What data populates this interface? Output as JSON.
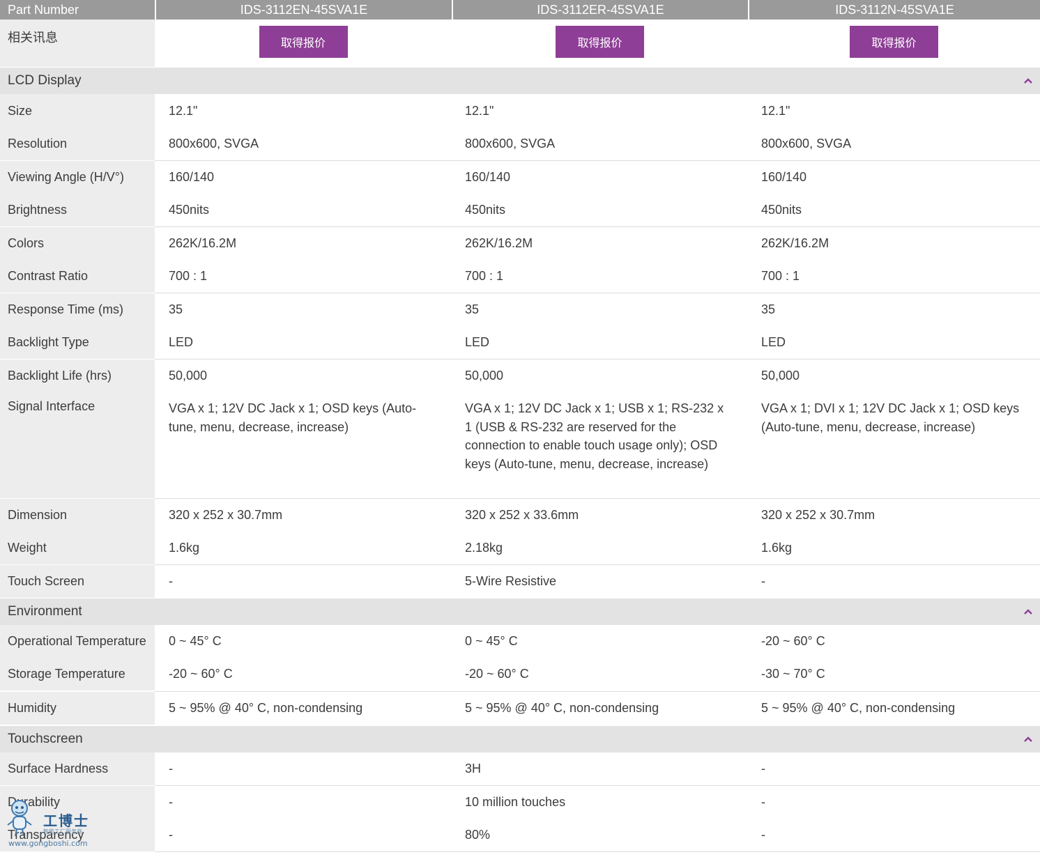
{
  "header": {
    "label": "Part Number",
    "products": [
      "IDS-3112EN-45SVA1E",
      "IDS-3112ER-45SVA1E",
      "IDS-3112N-45SVA1E"
    ]
  },
  "related": {
    "label": "相关讯息",
    "button_label": "取得报价"
  },
  "sections": {
    "lcd": {
      "title": "LCD Display"
    },
    "environment": {
      "title": "Environment"
    },
    "touchscreen": {
      "title": "Touchscreen"
    }
  },
  "rows": {
    "size": {
      "label": "Size",
      "values": [
        "12.1\"",
        "12.1\"",
        "12.1\""
      ]
    },
    "resolution": {
      "label": "Resolution",
      "values": [
        "800x600, SVGA",
        "800x600, SVGA",
        "800x600, SVGA"
      ]
    },
    "viewing_angle": {
      "label": "Viewing Angle (H/V°)",
      "values": [
        "160/140",
        "160/140",
        "160/140"
      ]
    },
    "brightness": {
      "label": "Brightness",
      "values": [
        "450nits",
        "450nits",
        "450nits"
      ]
    },
    "colors": {
      "label": "Colors",
      "values": [
        "262K/16.2M",
        "262K/16.2M",
        "262K/16.2M"
      ]
    },
    "contrast": {
      "label": "Contrast Ratio",
      "values": [
        "700 : 1",
        "700 : 1",
        "700 : 1"
      ]
    },
    "response": {
      "label": "Response Time (ms)",
      "values": [
        "35",
        "35",
        "35"
      ]
    },
    "backlight_type": {
      "label": "Backlight Type",
      "values": [
        "LED",
        "LED",
        "LED"
      ]
    },
    "backlight_life": {
      "label": "Backlight Life (hrs)",
      "values": [
        "50,000",
        "50,000",
        "50,000"
      ]
    },
    "signal": {
      "label": "Signal Interface",
      "values": [
        "VGA x 1; 12V DC Jack x 1; OSD keys (Auto-tune, menu, decrease, increase)",
        "VGA x 1; 12V DC Jack x 1; USB x 1; RS-232 x 1 (USB & RS-232 are reserved for the connection to enable touch usage only); OSD keys (Auto-tune, menu, decrease, increase)",
        "VGA x 1; DVI x 1; 12V DC Jack x 1; OSD keys (Auto-tune, menu, decrease, increase)"
      ]
    },
    "dimension": {
      "label": "Dimension",
      "values": [
        "320 x 252 x 30.7mm",
        "320 x 252 x 33.6mm",
        "320 x 252 x 30.7mm"
      ]
    },
    "weight": {
      "label": "Weight",
      "values": [
        "1.6kg",
        "2.18kg",
        "1.6kg"
      ]
    },
    "touch_screen": {
      "label": "Touch Screen",
      "values": [
        "-",
        "5-Wire Resistive",
        "-"
      ]
    },
    "op_temp": {
      "label": "Operational Temperature",
      "values": [
        "0 ~ 45° C",
        "0 ~ 45° C",
        "-20 ~ 60° C"
      ]
    },
    "storage_temp": {
      "label": "Storage Temperature",
      "values": [
        "-20 ~ 60° C",
        "-20 ~ 60° C",
        "-30 ~ 70° C"
      ]
    },
    "humidity": {
      "label": "Humidity",
      "values": [
        "5 ~ 95% @ 40° C, non-condensing",
        "5 ~ 95% @ 40° C, non-condensing",
        "5 ~ 95% @ 40° C, non-condensing"
      ]
    },
    "surface_hardness": {
      "label": "Surface Hardness",
      "values": [
        "-",
        "3H",
        "-"
      ]
    },
    "durability": {
      "label": "Durability",
      "values": [
        "-",
        "10 million touches",
        "-"
      ]
    },
    "transparency": {
      "label": "Transparency",
      "values": [
        "-",
        "80%",
        "-"
      ]
    }
  },
  "watermark": {
    "name": "工博士",
    "subtitle": "智能工厂服务商",
    "url": "www.gongboshi.com"
  },
  "colors": {
    "accent": "#8e3e96",
    "header_bg": "#9a9a9a",
    "section_bg": "#e3e3e3",
    "label_bg": "#ededed"
  }
}
